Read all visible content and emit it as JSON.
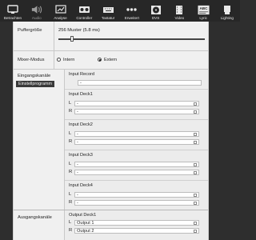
{
  "toolbar": {
    "items": [
      {
        "label": "Betrachten",
        "icon": "screen-icon"
      },
      {
        "label": "Audio",
        "icon": "speaker-icon"
      },
      {
        "label": "Analyse",
        "icon": "analysis-icon"
      },
      {
        "label": "Controller",
        "icon": "controller-icon"
      },
      {
        "label": "Tastatur",
        "icon": "keyboard-icon"
      },
      {
        "label": "Erweitert",
        "icon": "dots-icon"
      },
      {
        "label": "DVS",
        "icon": "vinyl-icon"
      },
      {
        "label": "Video",
        "icon": "film-icon"
      },
      {
        "label": "Lyric",
        "icon": "abc-icon"
      },
      {
        "label": "Lighting",
        "icon": "spotlight-icon"
      }
    ],
    "active": "Audio"
  },
  "puffer": {
    "label": "Puffergröße",
    "value": "256 Muster (5.8 ms)",
    "level": 0.08
  },
  "mixer": {
    "label": "Mixer-Modus",
    "option1": "Intern",
    "option2": "Extern",
    "selected": "Extern"
  },
  "eingang": {
    "label": "Eingangskanäle",
    "button": "Einstellprogramm",
    "record": {
      "title": "Input Record",
      "value": "-"
    },
    "decks": [
      {
        "title": "Input Deck1",
        "L": "-",
        "R": "-"
      },
      {
        "title": "Input Deck2",
        "L": "-",
        "R": "-"
      },
      {
        "title": "Input Deck3",
        "L": "-",
        "R": "-"
      },
      {
        "title": "Input Deck4",
        "L": "-",
        "R": "-"
      }
    ],
    "L": "L",
    "R": "R"
  },
  "ausgang": {
    "label": "Ausgangskanäle",
    "deck1": {
      "title": "Output Deck1",
      "L": "Output 1",
      "R": "Output 2"
    }
  },
  "colors": {
    "toolbar_bg": "#272727",
    "panel_bg": "#f0f0f0",
    "button_bg": "#3a3a3a"
  }
}
